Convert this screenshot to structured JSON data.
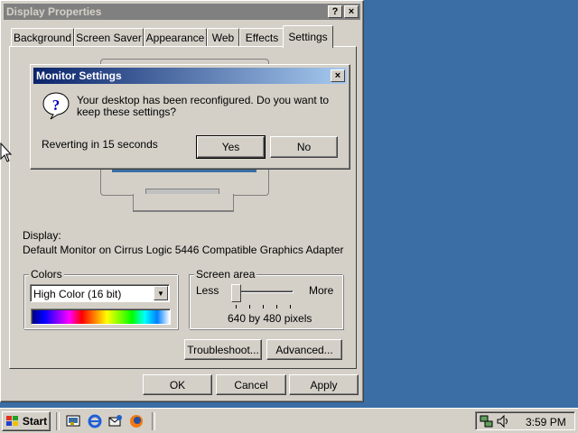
{
  "main_window": {
    "title": "Display Properties",
    "title_buttons": {
      "help": "?",
      "close": "×"
    },
    "tabs": [
      "Background",
      "Screen Saver",
      "Appearance",
      "Web",
      "Effects",
      "Settings"
    ],
    "active_tab": "Settings",
    "display_label": "Display:",
    "display_value": "Default Monitor on Cirrus Logic 5446 Compatible Graphics Adapter",
    "colors": {
      "title": "Colors",
      "selected": "High Color (16 bit)"
    },
    "screen_area": {
      "title": "Screen area",
      "less": "Less",
      "more": "More",
      "value_text": "640 by 480 pixels",
      "slider_position": 0
    },
    "buttons": {
      "troubleshoot": "Troubleshoot...",
      "advanced": "Advanced...",
      "ok": "OK",
      "cancel": "Cancel",
      "apply": "Apply"
    }
  },
  "dialog": {
    "title": "Monitor Settings",
    "close": "×",
    "message": "Your desktop has been reconfigured.  Do you want to keep these settings?",
    "countdown": "Reverting in 15 seconds",
    "yes": "Yes",
    "no": "No"
  },
  "taskbar": {
    "start_label": "Start",
    "clock": "3:59 PM"
  },
  "colors": {
    "desktop": "#3a6ea5",
    "face": "#d4d0c8",
    "active_title": "#0a246a",
    "inactive_title": "#808080"
  }
}
